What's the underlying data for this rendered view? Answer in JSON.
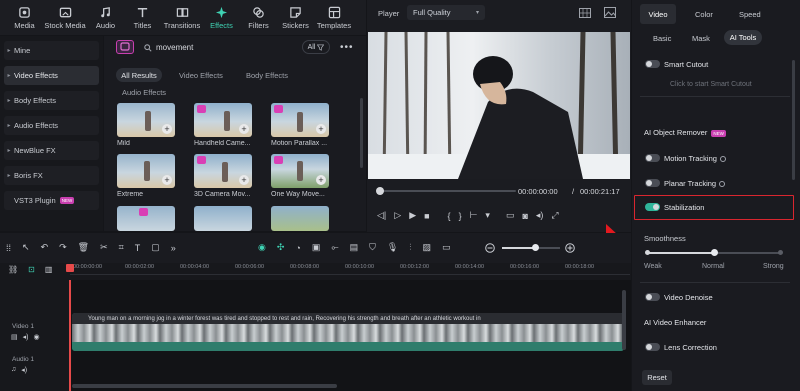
{
  "toolbar": {
    "tabs": [
      {
        "label": "Media",
        "icon": "media-icon"
      },
      {
        "label": "Stock Media",
        "icon": "stock-media-icon"
      },
      {
        "label": "Audio",
        "icon": "music-note-icon"
      },
      {
        "label": "Titles",
        "icon": "text-t-icon"
      },
      {
        "label": "Transitions",
        "icon": "transitions-icon"
      },
      {
        "label": "Effects",
        "icon": "effects-sparkle-icon",
        "active": true
      },
      {
        "label": "Filters",
        "icon": "filters-icon"
      },
      {
        "label": "Stickers",
        "icon": "stickers-icon"
      },
      {
        "label": "Templates",
        "icon": "templates-icon"
      }
    ]
  },
  "sidebar": {
    "items": [
      {
        "label": "Mine"
      },
      {
        "label": "Video Effects",
        "selected": true
      },
      {
        "label": "Body Effects"
      },
      {
        "label": "Audio Effects"
      },
      {
        "label": "NewBlue FX"
      },
      {
        "label": "Boris FX"
      },
      {
        "label": "VST3 Plugin",
        "badge": "NEW"
      }
    ]
  },
  "library": {
    "search_value": "movement",
    "filter_label": "All",
    "chips": [
      "All Results",
      "Video Effects",
      "Body Effects"
    ],
    "section": "Audio Effects",
    "effects": [
      {
        "label": "Mild"
      },
      {
        "label": "Handheld Came..."
      },
      {
        "label": "Motion Parallax ..."
      },
      {
        "label": "Extreme"
      },
      {
        "label": "3D Camera Mov..."
      },
      {
        "label": "One Way Move..."
      }
    ]
  },
  "player": {
    "label": "Player",
    "quality": "Full Quality",
    "current_time": "00:00:00:00",
    "separator": "/",
    "total_time": "00:00:21:17"
  },
  "panel": {
    "tabs": [
      "Video",
      "Color",
      "Speed"
    ],
    "subtabs": [
      "Basic",
      "Mask",
      "AI Tools"
    ],
    "smart_cutout": "Smart Cutout",
    "smart_cutout_hint": "Click to start Smart Cutout",
    "ai_object_remover": "AI Object Remover",
    "ai_object_remover_badge": "NEW",
    "motion_tracking": "Motion Tracking",
    "planar_tracking": "Planar Tracking",
    "stabilization": "Stabilization",
    "smoothness": "Smoothness",
    "smoothness_levels": [
      "Weak",
      "Normal",
      "Strong"
    ],
    "smoothness_value": "Normal",
    "video_denoise": "Video Denoise",
    "ai_video_enhancer": "AI Video Enhancer",
    "lens_correction": "Lens Correction",
    "reset": "Reset"
  },
  "timeline": {
    "ticks": [
      "00:00:00:00",
      "00:00:02:00",
      "00:00:04:00",
      "00:00:06:00",
      "00:00:08:00",
      "00:00:10:00",
      "00:00:12:00",
      "00:00:14:00",
      "00:00:16:00",
      "00:00:18:00"
    ],
    "video_track": "Video 1",
    "audio_track": "Audio 1",
    "clip_title": "Young man on a morning jog in a winter forest was tired and stopped to rest and rain, Recovering his strength and breath after an athletic workout in"
  },
  "colors": {
    "accent": "#3fd3b4",
    "highlight_border": "#d9262f",
    "arrow": "#e3191f"
  }
}
